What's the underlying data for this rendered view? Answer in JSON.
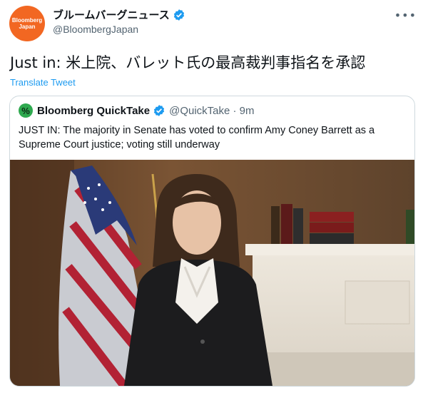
{
  "author": {
    "avatar_text_line1": "Bloomberg",
    "avatar_text_line2": "Japan",
    "display_name": "ブルームバーグニュース",
    "handle": "@BloombergJapan"
  },
  "more_label": "•••",
  "tweet": {
    "text": "Just in: 米上院、バレット氏の最高裁判事指名を承認",
    "translate_label": "Translate Tweet"
  },
  "quoted_tweet": {
    "icon_glyph": "%",
    "name": "Bloomberg QuickTake",
    "meta": "@QuickTake · 9m",
    "text": "JUST IN: The majority in Senate has voted to confirm Amy Coney Barrett as a Supreme Court justice; voting still underway"
  },
  "colors": {
    "brand_orange": "#f26722",
    "link_blue": "#1d9bf0",
    "verified_blue": "#1d9bf0",
    "quicktake_green": "#2ea94f"
  },
  "icons": {
    "verified": "verified-badge-icon",
    "more": "more-options-icon",
    "quicktake": "quicktake-logo-icon"
  }
}
